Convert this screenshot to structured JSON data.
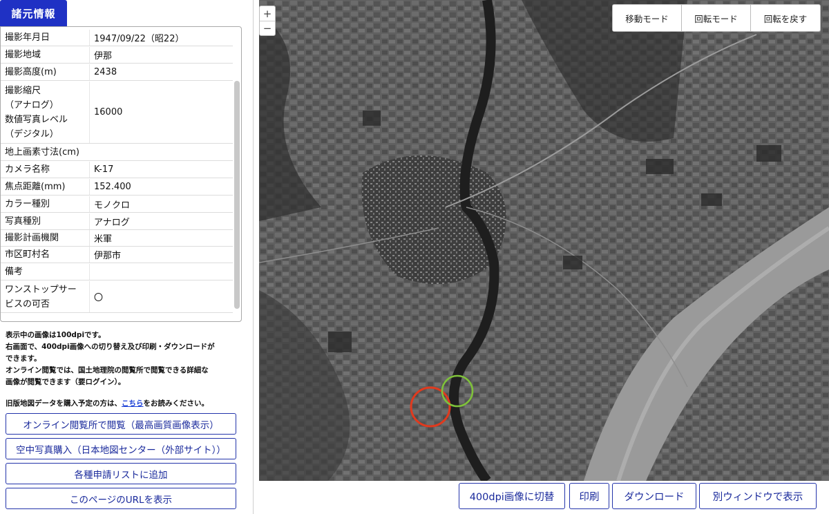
{
  "tab_label": "諸元情報",
  "specs": [
    {
      "label": "撮影年月日",
      "value": "1947/09/22（昭22）"
    },
    {
      "label": "撮影地域",
      "value": "伊那"
    },
    {
      "label": "撮影高度(m)",
      "value": "2438"
    },
    {
      "label": "撮影縮尺\n（アナログ）\n数値写真レベル\n（デジタル）",
      "value": "16000"
    },
    {
      "label": "地上画素寸法(cm)",
      "value": ""
    },
    {
      "label": "カメラ名称",
      "value": "K-17"
    },
    {
      "label": "焦点距離(mm)",
      "value": "152.400"
    },
    {
      "label": "カラー種別",
      "value": "モノクロ"
    },
    {
      "label": "写真種別",
      "value": "アナログ"
    },
    {
      "label": "撮影計画機関",
      "value": "米軍"
    },
    {
      "label": "市区町村名",
      "value": "伊那市"
    },
    {
      "label": "備考",
      "value": ""
    },
    {
      "label": "ワンストップサー\nビスの可否",
      "value": "〇"
    }
  ],
  "notes": [
    "表示中の画像は100dpiです。",
    "右画面で、400dpi画像への切り替え及び印刷・ダウンロードが",
    "できます。",
    "オンライン閲覧では、国土地理院の閲覧所で閲覧できる詳細な",
    "画像が閲覧できます（要ログイン）。"
  ],
  "purchase": {
    "prefix": "旧版地図データを購入予定の方は、",
    "link": "こちら",
    "suffix": "をお読みください。"
  },
  "left_buttons": [
    "オンライン閲覧所で閲覧（最高画質画像表示）",
    "空中写真購入（日本地図センター（外部サイト））",
    "各種申請リストに追加",
    "このページのURLを表示"
  ],
  "zoom": {
    "in": "+",
    "out": "−"
  },
  "mode_buttons": [
    "移動モード",
    "回転モード",
    "回転を戻す"
  ],
  "bottom_buttons": [
    "400dpi画像に切替",
    "印刷",
    "ダウンロード",
    "別ウィンドウで表示"
  ],
  "colors": {
    "tab_bg": "#1f31c4",
    "button_border": "#2233aa",
    "link": "#1a3fd6",
    "marker_red": "#e03a1e",
    "marker_green": "#7fc23a"
  }
}
